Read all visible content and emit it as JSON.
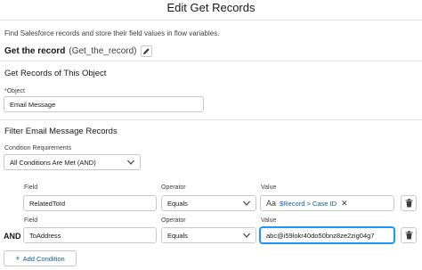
{
  "modal": {
    "title": "Edit Get Records"
  },
  "description": "Find Salesforce records and store their field values in flow variables.",
  "record": {
    "label": "Get the record",
    "api_name": "(Get_the_record)"
  },
  "object_section": {
    "heading": "Get Records of This Object",
    "object_label": "Object",
    "required_marker": "*",
    "object_value": "Email Message"
  },
  "filter_section": {
    "heading": "Filter Email Message Records",
    "condition_label": "Condition Requirements",
    "condition_value": "All Conditions Are Met (AND)"
  },
  "conditions": [
    {
      "prefix": "",
      "field_label": "Field",
      "field_value": "RelatedToId",
      "operator_label": "Operator",
      "operator_value": "Equals",
      "value_label": "Value",
      "value_text": "$Record > Case ID",
      "value_icon": "Aa"
    },
    {
      "prefix": "AND",
      "field_label": "Field",
      "field_value": "ToAddress",
      "operator_label": "Operator",
      "operator_value": "Equals",
      "value_label": "Value",
      "value_text": "abc@i59lokr40do50bnz8ze2zig04g7"
    }
  ],
  "add_condition_label": "Add Condition",
  "colors": {
    "brand": "#0b5cab",
    "focus": "#1b96ff",
    "border": "#c9c9c9",
    "required": "#ba0517"
  },
  "icons": {
    "edit": "pencil-icon",
    "delete": "trash-icon",
    "clear": "close-icon",
    "dropdown": "chevron-down-icon",
    "text_type": "text-type-icon",
    "add": "plus-icon"
  }
}
